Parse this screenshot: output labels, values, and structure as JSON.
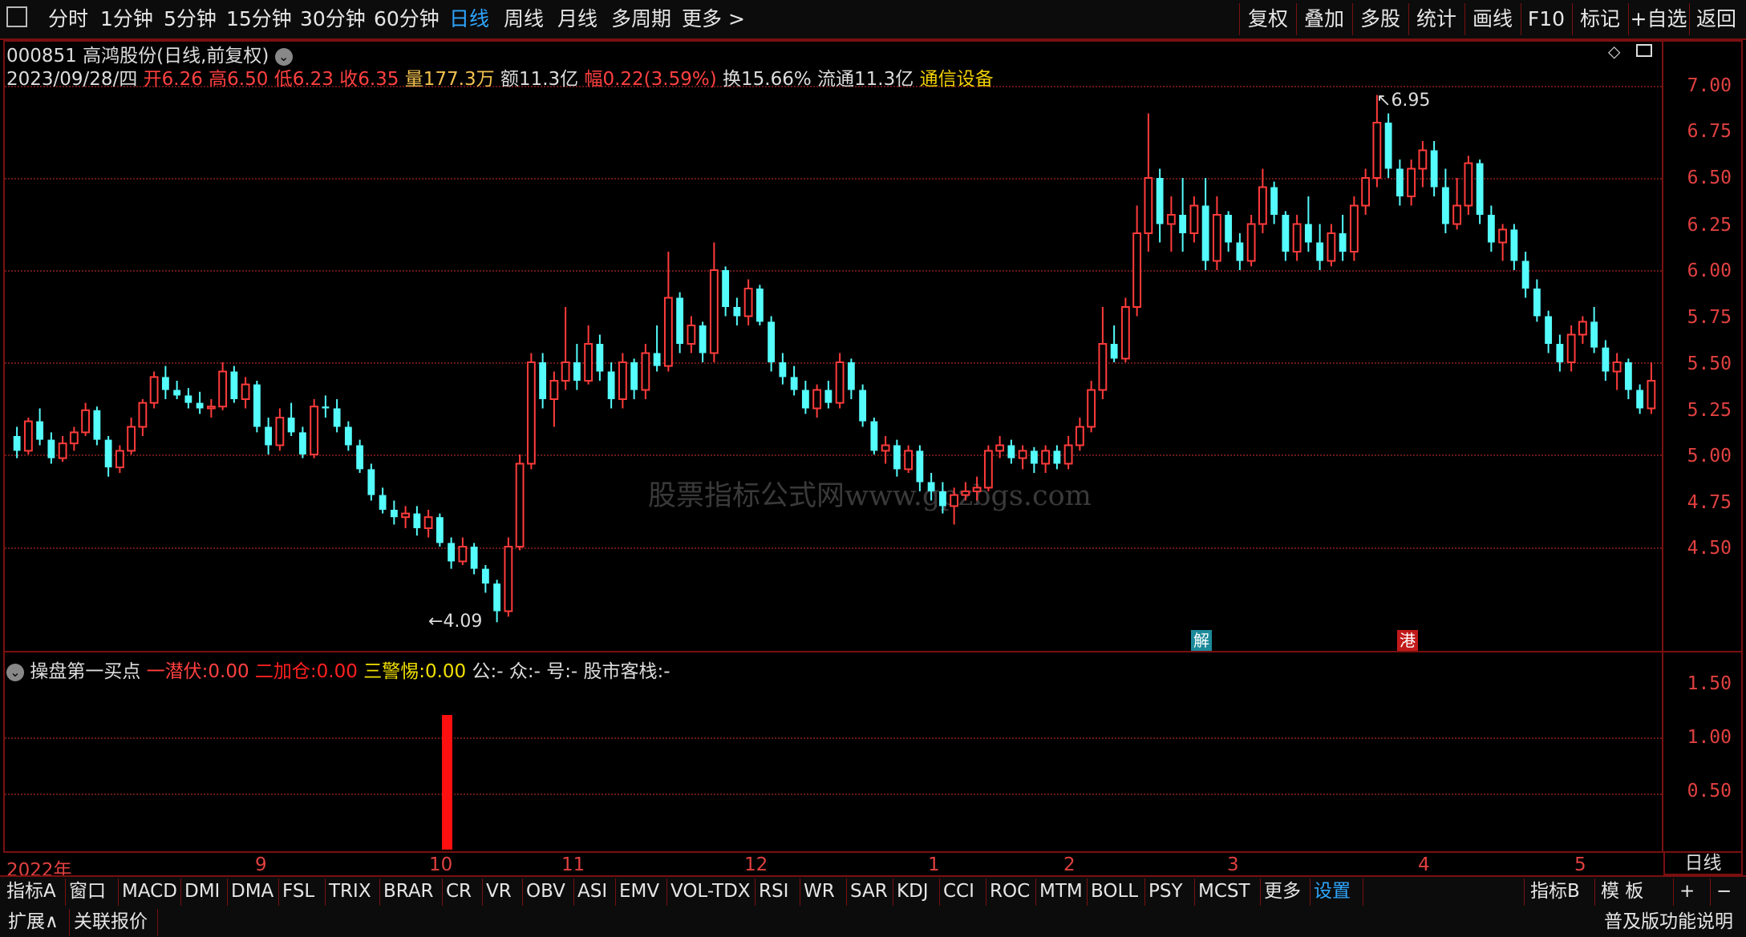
{
  "toolbar": {
    "periods": [
      "分时",
      "1分钟",
      "5分钟",
      "15分钟",
      "30分钟",
      "60分钟",
      "日线",
      "周线",
      "月线",
      "多周期"
    ],
    "active_period": "日线",
    "more": "更多",
    "right_buttons": [
      "复权",
      "叠加",
      "多股",
      "统计",
      "画线",
      "F10",
      "标记",
      "+自选",
      "返回"
    ]
  },
  "header": {
    "code": "000851",
    "name": "高鸿股份",
    "mode": "(日线,前复权)",
    "date": "2023/09/28/四",
    "open_label": "开",
    "open": "6.26",
    "high_label": "高",
    "high": "6.50",
    "low_label": "低",
    "low": "6.23",
    "close_label": "收",
    "close": "6.35",
    "vol_label": "量",
    "vol": "177.3万",
    "amt_label": "额",
    "amt": "11.3亿",
    "chg_label": "幅",
    "chg": "0.22(3.59%)",
    "turn_label": "换",
    "turn": "15.66%",
    "float_label": "流通",
    "float": "11.3亿",
    "sector": "通信设备"
  },
  "price_axis": [
    "7.00",
    "6.75",
    "6.50",
    "6.25",
    "6.00",
    "5.75",
    "5.50",
    "5.25",
    "5.00",
    "4.75",
    "4.50"
  ],
  "annotations": {
    "high": "6.95",
    "low": "4.09",
    "tag_jie": "解",
    "tag_gang": "港"
  },
  "watermark": "股票指标公式网www.gpzbgs.com",
  "indicator": {
    "name": "操盘第一买点",
    "l1_label": "一潜伏:",
    "l1_value": "0.00",
    "l2_label": "二加仓:",
    "l2_value": "0.00",
    "l3_label": "三警惕:",
    "l3_value": "0.00",
    "extra": "公:- 众:- 号:- 股市客栈:-",
    "axis": [
      "1.50",
      "1.00",
      "0.50"
    ],
    "bar_value": 1.2
  },
  "x_axis": {
    "labels": [
      "2022年",
      "9",
      "10",
      "11",
      "12",
      "1",
      "2",
      "3",
      "4",
      "5"
    ],
    "period_box": "日线"
  },
  "bottom_tabs": [
    "指标A",
    "窗口",
    "MACD",
    "DMI",
    "DMA",
    "FSL",
    "TRIX",
    "BRAR",
    "CR",
    "VR",
    "OBV",
    "ASI",
    "EMV",
    "VOL-TDX",
    "RSI",
    "WR",
    "SAR",
    "KDJ",
    "CCI",
    "ROC",
    "MTM",
    "BOLL",
    "PSY",
    "MCST",
    "更多",
    "设置"
  ],
  "active_tab": "设置",
  "bottom_right": {
    "indicator_b": "指标B",
    "template": "模 板",
    "plus": "+",
    "minus": "−"
  },
  "status": {
    "expand": "扩展∧",
    "related": "关联报价",
    "right": "普及版功能说明"
  },
  "colors": {
    "up": "#ff3b3b",
    "down": "#54fcfc",
    "frame": "#7a1010"
  },
  "chart_data": {
    "type": "candlestick",
    "ylim": [
      4.0,
      7.1
    ],
    "candles": [
      [
        5.1,
        5.15,
        4.98,
        5.02
      ],
      [
        5.02,
        5.2,
        5.0,
        5.18
      ],
      [
        5.18,
        5.25,
        5.05,
        5.08
      ],
      [
        5.08,
        5.12,
        4.95,
        4.98
      ],
      [
        4.98,
        5.1,
        4.96,
        5.06
      ],
      [
        5.06,
        5.15,
        5.02,
        5.12
      ],
      [
        5.12,
        5.28,
        5.1,
        5.24
      ],
      [
        5.24,
        5.26,
        5.05,
        5.08
      ],
      [
        5.08,
        5.1,
        4.88,
        4.93
      ],
      [
        4.93,
        5.05,
        4.9,
        5.02
      ],
      [
        5.02,
        5.2,
        5.0,
        5.15
      ],
      [
        5.15,
        5.3,
        5.1,
        5.28
      ],
      [
        5.28,
        5.45,
        5.25,
        5.42
      ],
      [
        5.42,
        5.48,
        5.3,
        5.35
      ],
      [
        5.35,
        5.4,
        5.3,
        5.32
      ],
      [
        5.32,
        5.36,
        5.25,
        5.28
      ],
      [
        5.28,
        5.34,
        5.22,
        5.25
      ],
      [
        5.25,
        5.3,
        5.2,
        5.26
      ],
      [
        5.26,
        5.5,
        5.24,
        5.45
      ],
      [
        5.45,
        5.48,
        5.28,
        5.3
      ],
      [
        5.3,
        5.42,
        5.25,
        5.38
      ],
      [
        5.38,
        5.4,
        5.12,
        5.15
      ],
      [
        5.15,
        5.2,
        5.0,
        5.05
      ],
      [
        5.05,
        5.25,
        5.02,
        5.2
      ],
      [
        5.2,
        5.28,
        5.1,
        5.12
      ],
      [
        5.12,
        5.15,
        4.98,
        5.0
      ],
      [
        5.0,
        5.3,
        4.98,
        5.26
      ],
      [
        5.26,
        5.32,
        5.2,
        5.25
      ],
      [
        5.25,
        5.3,
        5.12,
        5.15
      ],
      [
        5.15,
        5.18,
        5.02,
        5.05
      ],
      [
        5.05,
        5.08,
        4.9,
        4.92
      ],
      [
        4.92,
        4.95,
        4.75,
        4.78
      ],
      [
        4.78,
        4.82,
        4.68,
        4.7
      ],
      [
        4.7,
        4.75,
        4.62,
        4.66
      ],
      [
        4.66,
        4.72,
        4.6,
        4.68
      ],
      [
        4.68,
        4.72,
        4.56,
        4.6
      ],
      [
        4.6,
        4.7,
        4.55,
        4.66
      ],
      [
        4.66,
        4.68,
        4.5,
        4.52
      ],
      [
        4.52,
        4.55,
        4.38,
        4.42
      ],
      [
        4.42,
        4.55,
        4.4,
        4.5
      ],
      [
        4.5,
        4.52,
        4.35,
        4.38
      ],
      [
        4.38,
        4.4,
        4.25,
        4.3
      ],
      [
        4.3,
        4.32,
        4.09,
        4.15
      ],
      [
        4.15,
        4.55,
        4.12,
        4.5
      ],
      [
        4.5,
        5.0,
        4.48,
        4.95
      ],
      [
        4.95,
        5.55,
        4.92,
        5.5
      ],
      [
        5.5,
        5.55,
        5.25,
        5.3
      ],
      [
        5.3,
        5.45,
        5.15,
        5.4
      ],
      [
        5.4,
        5.8,
        5.35,
        5.5
      ],
      [
        5.5,
        5.6,
        5.35,
        5.4
      ],
      [
        5.4,
        5.7,
        5.38,
        5.6
      ],
      [
        5.6,
        5.65,
        5.4,
        5.45
      ],
      [
        5.45,
        5.5,
        5.25,
        5.3
      ],
      [
        5.3,
        5.55,
        5.25,
        5.5
      ],
      [
        5.5,
        5.52,
        5.3,
        5.35
      ],
      [
        5.35,
        5.6,
        5.3,
        5.55
      ],
      [
        5.55,
        5.7,
        5.45,
        5.48
      ],
      [
        5.48,
        6.1,
        5.45,
        5.85
      ],
      [
        5.85,
        5.88,
        5.55,
        5.6
      ],
      [
        5.6,
        5.75,
        5.55,
        5.7
      ],
      [
        5.7,
        5.72,
        5.5,
        5.55
      ],
      [
        5.55,
        6.15,
        5.5,
        6.0
      ],
      [
        6.0,
        6.02,
        5.75,
        5.8
      ],
      [
        5.8,
        5.85,
        5.7,
        5.75
      ],
      [
        5.75,
        5.95,
        5.7,
        5.9
      ],
      [
        5.9,
        5.92,
        5.7,
        5.72
      ],
      [
        5.72,
        5.75,
        5.45,
        5.5
      ],
      [
        5.5,
        5.55,
        5.38,
        5.42
      ],
      [
        5.42,
        5.48,
        5.32,
        5.35
      ],
      [
        5.35,
        5.4,
        5.22,
        5.25
      ],
      [
        5.25,
        5.38,
        5.2,
        5.35
      ],
      [
        5.35,
        5.4,
        5.25,
        5.28
      ],
      [
        5.28,
        5.55,
        5.25,
        5.5
      ],
      [
        5.5,
        5.52,
        5.3,
        5.35
      ],
      [
        5.35,
        5.38,
        5.15,
        5.18
      ],
      [
        5.18,
        5.2,
        5.0,
        5.02
      ],
      [
        5.02,
        5.1,
        4.95,
        5.05
      ],
      [
        5.05,
        5.08,
        4.88,
        4.92
      ],
      [
        4.92,
        5.05,
        4.9,
        5.02
      ],
      [
        5.02,
        5.05,
        4.8,
        4.85
      ],
      [
        4.85,
        4.9,
        4.75,
        4.8
      ],
      [
        4.8,
        4.85,
        4.68,
        4.72
      ],
      [
        4.72,
        4.82,
        4.62,
        4.78
      ],
      [
        4.78,
        4.85,
        4.75,
        4.8
      ],
      [
        4.8,
        4.88,
        4.75,
        4.82
      ],
      [
        4.82,
        5.05,
        4.8,
        5.02
      ],
      [
        5.02,
        5.1,
        4.98,
        5.05
      ],
      [
        5.05,
        5.08,
        4.95,
        4.98
      ],
      [
        4.98,
        5.05,
        4.92,
        5.02
      ],
      [
        5.02,
        5.04,
        4.9,
        4.95
      ],
      [
        4.95,
        5.05,
        4.9,
        5.02
      ],
      [
        5.02,
        5.05,
        4.92,
        4.95
      ],
      [
        4.95,
        5.1,
        4.92,
        5.05
      ],
      [
        5.05,
        5.2,
        5.02,
        5.15
      ],
      [
        5.15,
        5.4,
        5.12,
        5.35
      ],
      [
        5.35,
        5.8,
        5.3,
        5.6
      ],
      [
        5.6,
        5.7,
        5.5,
        5.52
      ],
      [
        5.52,
        5.85,
        5.5,
        5.8
      ],
      [
        5.8,
        6.35,
        5.75,
        6.2
      ],
      [
        6.2,
        6.85,
        6.1,
        6.5
      ],
      [
        6.5,
        6.55,
        6.15,
        6.25
      ],
      [
        6.25,
        6.4,
        6.1,
        6.3
      ],
      [
        6.3,
        6.5,
        6.1,
        6.2
      ],
      [
        6.2,
        6.4,
        6.15,
        6.35
      ],
      [
        6.35,
        6.5,
        6.0,
        6.05
      ],
      [
        6.05,
        6.4,
        6.0,
        6.3
      ],
      [
        6.3,
        6.32,
        6.1,
        6.15
      ],
      [
        6.15,
        6.2,
        6.0,
        6.05
      ],
      [
        6.05,
        6.3,
        6.02,
        6.25
      ],
      [
        6.25,
        6.55,
        6.2,
        6.45
      ],
      [
        6.45,
        6.48,
        6.25,
        6.3
      ],
      [
        6.3,
        6.32,
        6.05,
        6.1
      ],
      [
        6.1,
        6.3,
        6.05,
        6.25
      ],
      [
        6.25,
        6.4,
        6.1,
        6.15
      ],
      [
        6.15,
        6.25,
        6.0,
        6.05
      ],
      [
        6.05,
        6.25,
        6.02,
        6.2
      ],
      [
        6.2,
        6.3,
        6.05,
        6.1
      ],
      [
        6.1,
        6.4,
        6.05,
        6.35
      ],
      [
        6.35,
        6.55,
        6.3,
        6.5
      ],
      [
        6.5,
        6.95,
        6.45,
        6.8
      ],
      [
        6.8,
        6.85,
        6.5,
        6.55
      ],
      [
        6.55,
        6.6,
        6.35,
        6.4
      ],
      [
        6.4,
        6.6,
        6.35,
        6.55
      ],
      [
        6.55,
        6.7,
        6.45,
        6.65
      ],
      [
        6.65,
        6.7,
        6.4,
        6.45
      ],
      [
        6.45,
        6.55,
        6.2,
        6.25
      ],
      [
        6.25,
        6.5,
        6.22,
        6.35
      ],
      [
        6.35,
        6.62,
        6.3,
        6.58
      ],
      [
        6.58,
        6.6,
        6.25,
        6.3
      ],
      [
        6.3,
        6.35,
        6.1,
        6.15
      ],
      [
        6.15,
        6.25,
        6.05,
        6.22
      ],
      [
        6.22,
        6.25,
        6.0,
        6.05
      ],
      [
        6.05,
        6.1,
        5.85,
        5.9
      ],
      [
        5.9,
        5.95,
        5.72,
        5.75
      ],
      [
        5.75,
        5.78,
        5.55,
        5.6
      ],
      [
        5.6,
        5.65,
        5.45,
        5.5
      ],
      [
        5.5,
        5.7,
        5.45,
        5.65
      ],
      [
        5.65,
        5.75,
        5.6,
        5.72
      ],
      [
        5.72,
        5.8,
        5.55,
        5.58
      ],
      [
        5.58,
        5.62,
        5.4,
        5.45
      ],
      [
        5.45,
        5.55,
        5.35,
        5.5
      ],
      [
        5.5,
        5.52,
        5.3,
        5.35
      ],
      [
        5.35,
        5.38,
        5.22,
        5.25
      ],
      [
        5.25,
        5.5,
        5.22,
        5.4
      ]
    ]
  }
}
